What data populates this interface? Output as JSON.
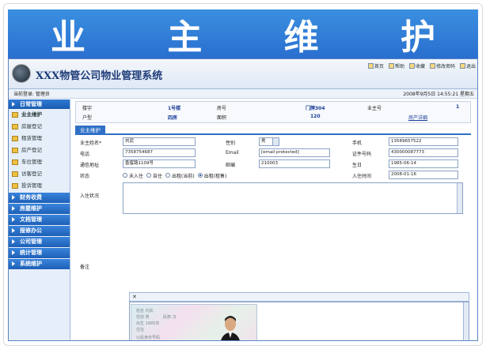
{
  "banner": {
    "title": "业 主 维 护"
  },
  "app": {
    "system_name": "XXX物管公司物业管理系统",
    "toolbar": [
      {
        "label": "首页",
        "icon": "home-icon"
      },
      {
        "label": "帮助",
        "icon": "help-icon"
      },
      {
        "label": "收藏",
        "icon": "favorite-icon"
      },
      {
        "label": "修改密码",
        "icon": "key-icon"
      },
      {
        "label": "退出",
        "icon": "exit-icon"
      }
    ],
    "status_left": "当前登录: 管理员",
    "status_right": "2008年9月5日 14:55:21 星期五"
  },
  "sidebar": {
    "head": "日常管理",
    "items": [
      {
        "label": "业主维护",
        "active": true
      },
      {
        "label": "房屋登记",
        "active": false
      },
      {
        "label": "租赁管理",
        "active": false
      },
      {
        "label": "房产登记",
        "active": false
      },
      {
        "label": "车位管理",
        "active": false
      },
      {
        "label": "访客登记",
        "active": false
      },
      {
        "label": "投诉管理",
        "active": false
      }
    ],
    "groups": [
      "财务收费",
      "房屋维护",
      "文档管理",
      "报修办公",
      "公司管理",
      "统计管理",
      "系统维护"
    ]
  },
  "info": {
    "building_label": "楼宇",
    "building_value": "1号楼",
    "room_label": "房号",
    "room_value": "门牌304",
    "owner_label": "户型",
    "owner_value": "四房",
    "area_label": "面积",
    "area_value": "120",
    "tenant_label": "业主号",
    "tenant_value": "1",
    "link": "房产详细"
  },
  "tab": "业主维护",
  "form": {
    "name_label": "业主姓名*",
    "name_value": "刘武",
    "gender_label": "性别",
    "gender_value": "男",
    "mobile_label": "手机",
    "mobile_value": "13589657522",
    "phone_label": "电话",
    "phone_value": "7358754687",
    "email_label": "Email",
    "email_value": "[email protected]",
    "idcard_label": "证件号码",
    "idcard_value": "430000087773",
    "address_label": "通信地址",
    "address_value": "香蜜路1109号",
    "zip_label": "邮编",
    "zip_value": "210003",
    "birth_label": "生日",
    "birth_value": "1985-06-14",
    "status_label": "状态",
    "status_options": [
      "未入住",
      "自住",
      "出租(当前)",
      "出租(租售)"
    ],
    "status_selected": 3,
    "checkin_label": "入住时间",
    "checkin_value": "2008-01-16",
    "remarks_label": "入住状况",
    "note_label": "备注"
  },
  "attachment": {
    "close": "✕"
  },
  "photo_text": [
    "姓名 刘武",
    "性别 男",
    "民族 汉",
    "出生 1985年",
    "住址",
    "公民身份号码"
  ]
}
